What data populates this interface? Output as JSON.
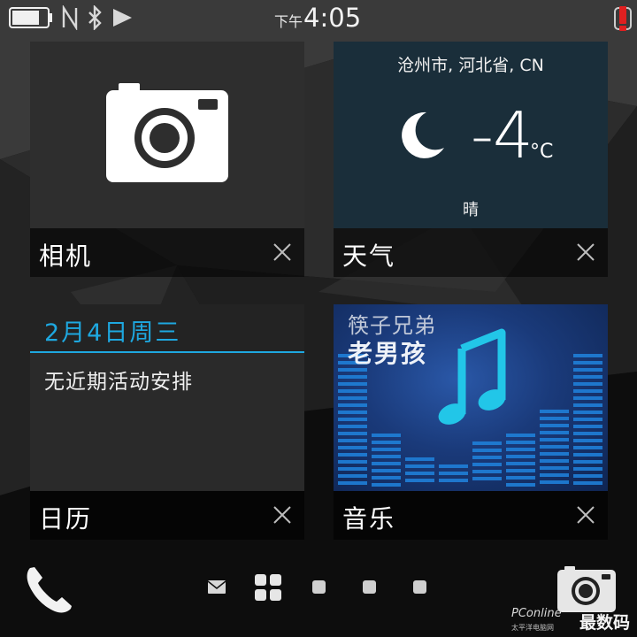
{
  "status_bar": {
    "ampm": "下午",
    "time": "4:05",
    "battery_level": 0.75,
    "icons": [
      "battery-icon",
      "nfc-icon",
      "bluetooth-icon",
      "play-icon",
      "alert-icon"
    ]
  },
  "tiles": [
    {
      "id": "camera",
      "title": "相机",
      "icon": "camera-icon"
    },
    {
      "id": "weather",
      "title": "天气",
      "location": "沧州市, 河北省, CN",
      "temperature": "-4",
      "unit": "°C",
      "condition": "晴",
      "icon": "moon-icon"
    },
    {
      "id": "calendar",
      "title": "日历",
      "date": "2月4日周三",
      "empty_text": "无近期活动安排"
    },
    {
      "id": "music",
      "title": "音乐",
      "artist": "筷子兄弟",
      "song": "老男孩",
      "icon": "music-note-icon"
    }
  ],
  "dock": {
    "icons": [
      "phone-icon",
      "mail-icon",
      "apps-icon",
      "page-dot",
      "page-dot",
      "page-dot",
      "camera-icon"
    ]
  },
  "watermark": {
    "logo": "PConline",
    "sub": "太平洋电脑网",
    "brand": "最数码"
  },
  "colors": {
    "accent": "#1ea8e0",
    "tile_bg": "#2e2e2e",
    "alert": "#e02020"
  }
}
